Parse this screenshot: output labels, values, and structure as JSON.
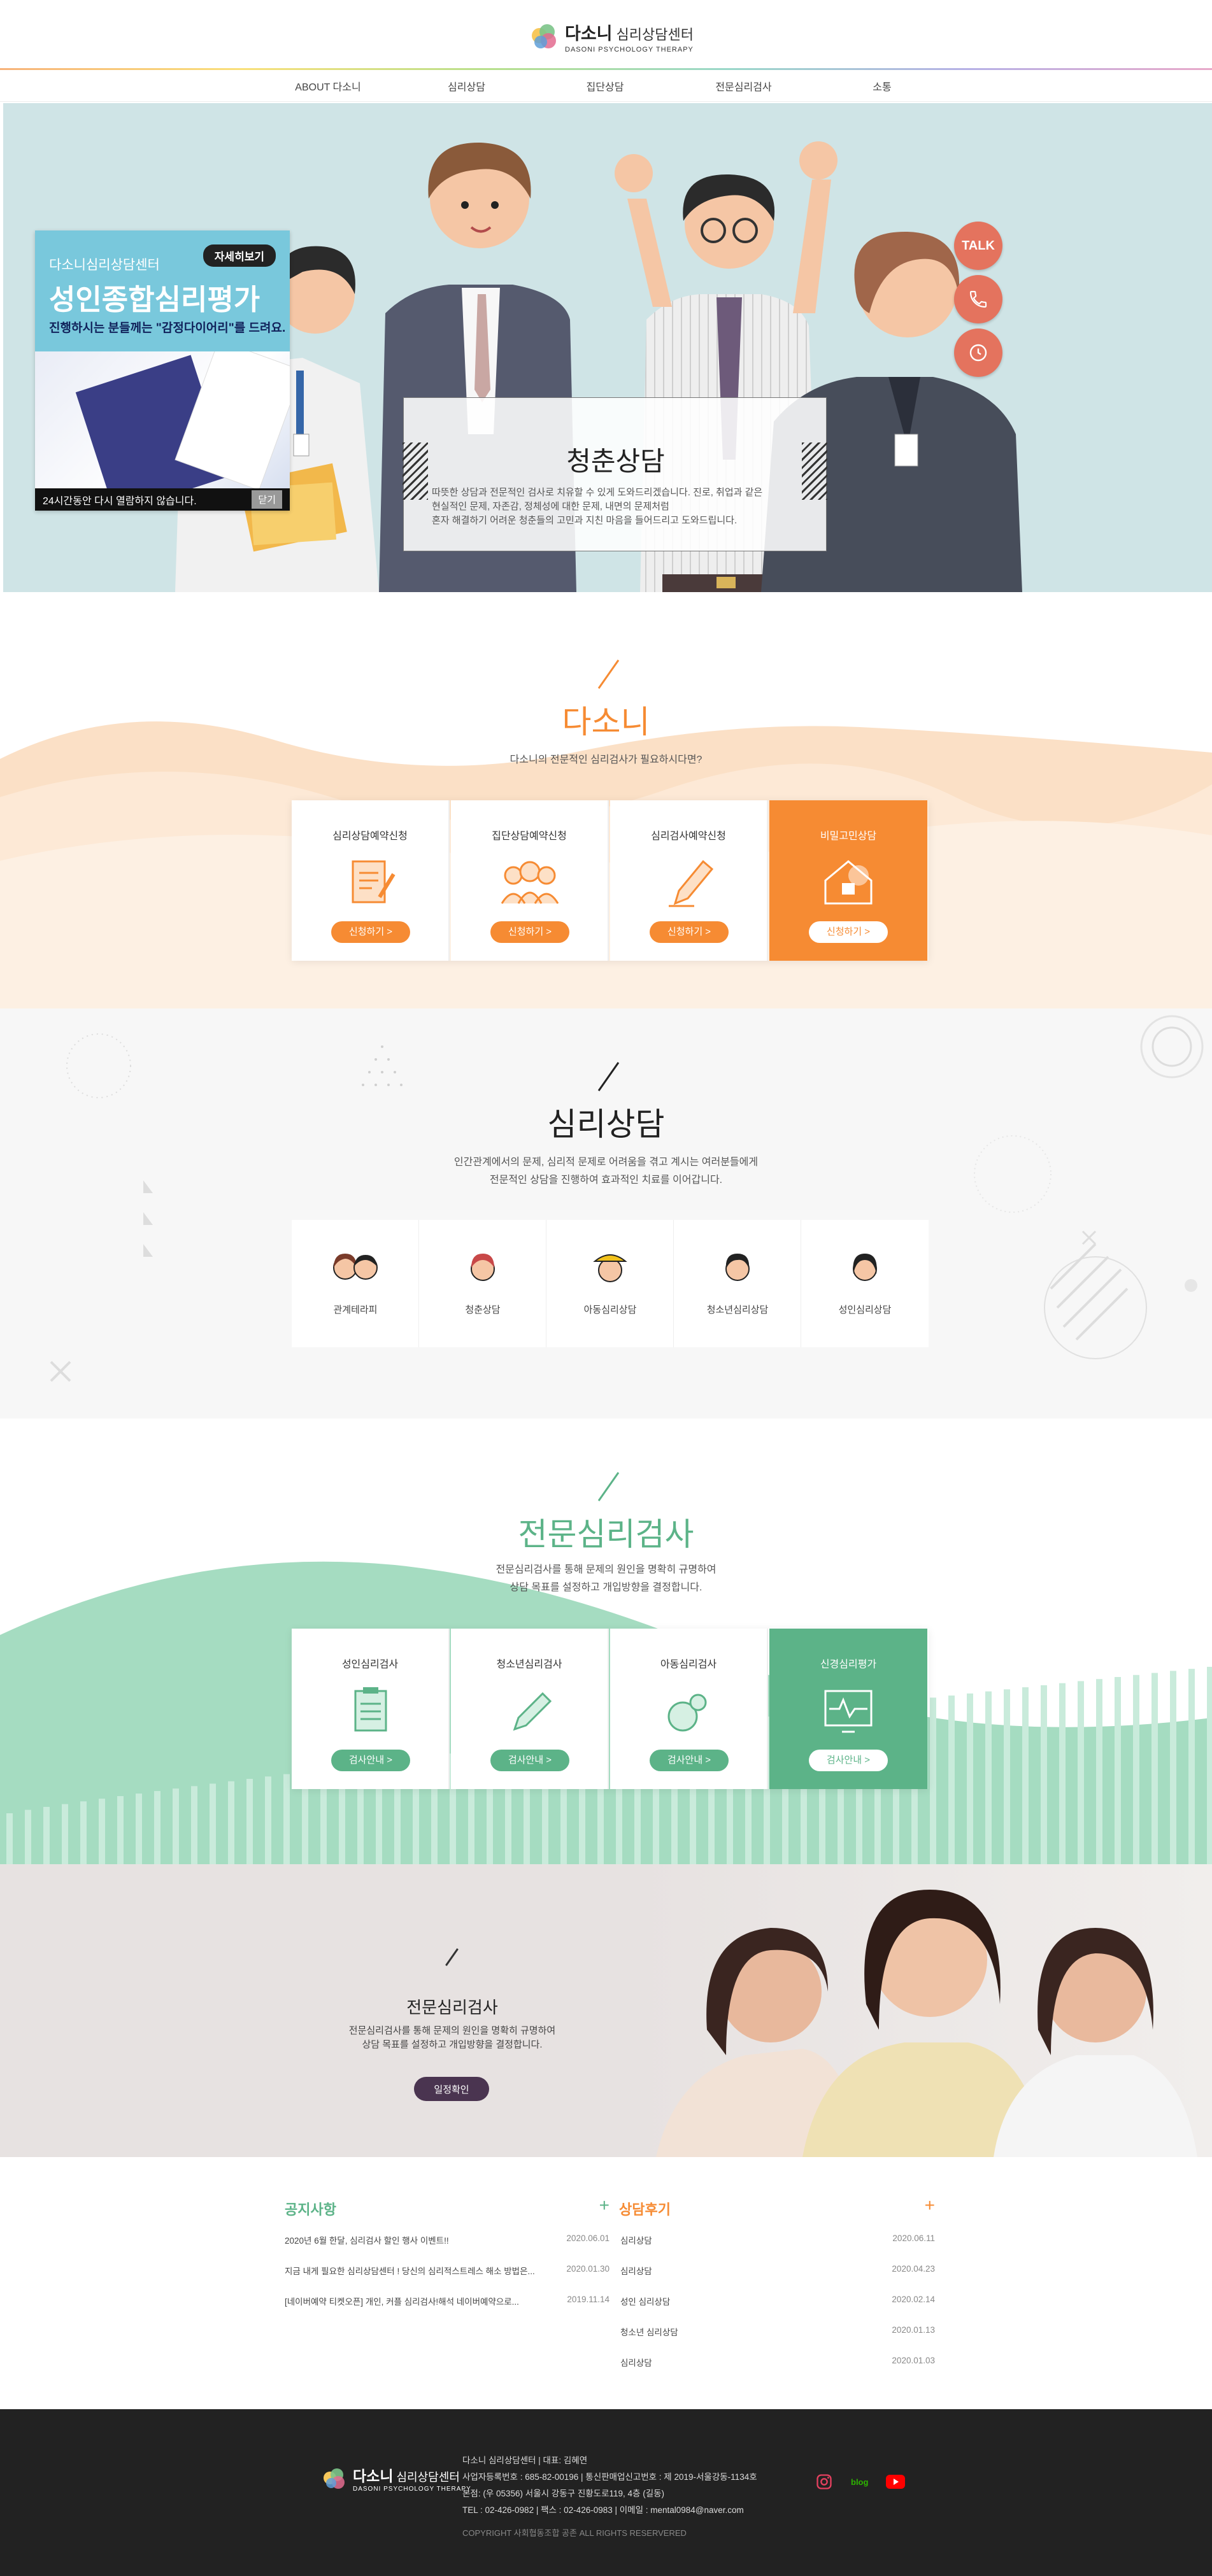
{
  "header": {
    "logo_name": "다소니",
    "logo_suffix": "심리상담센터",
    "logo_sub": "DASONI PSYCHOLOGY THERAPY",
    "nav": [
      "ABOUT 다소니",
      "심리상담",
      "집단상담",
      "전문심리검사",
      "소통"
    ]
  },
  "popup": {
    "sub": "다소니심리상담센터",
    "badge": "자세히보기",
    "title": "성인종합심리평가",
    "desc": "진행하시는 분들께는 \"감정다이어리\"를 드려요.",
    "hide_text": "24시간동안 다시 열람하지 않습니다.",
    "close": "닫기"
  },
  "hero": {
    "title": "청춘상담",
    "desc_lines": [
      "따뜻한 상담과 전문적인 검사로 치유할 수 있게 도와드리겠습니다. 진로, 취업과 같은",
      "현실적인 문제, 자존감, 정체성에 대한 문제, 내면의 문제처럼",
      "혼자 해결하기 어려운 청춘들의 고민과 지친 마음을 들어드리고 도와드립니다."
    ],
    "side_talk": "TALK"
  },
  "dasoni": {
    "title": "다소니",
    "sub": "다소니의 전문적인 심리검사가 필요하시다면?",
    "cards": [
      {
        "title": "심리상담예약신청",
        "button": "신청하기 >"
      },
      {
        "title": "집단상담예약신청",
        "button": "신청하기 >"
      },
      {
        "title": "심리검사예약신청",
        "button": "신청하기 >"
      },
      {
        "title": "비밀고민상담",
        "button": "신청하기 >"
      }
    ]
  },
  "counsel": {
    "title": "심리상담",
    "sub1": "인간관계에서의 문제, 심리적 문제로 어려움을 겪고 계시는 여러분들에게",
    "sub2": "전문적인 상담을 진행하여 효과적인 치료를 이어갑니다.",
    "items": [
      "관계테라피",
      "청춘상담",
      "아동심리상담",
      "청소년심리상담",
      "성인심리상담"
    ]
  },
  "test": {
    "title": "전문심리검사",
    "sub1": "전문심리검사를 통해 문제의 원인을 명확히 규명하여",
    "sub2": "상담 목표를 설정하고 개입방향을 결정합니다.",
    "cards": [
      {
        "title": "성인심리검사",
        "button": "검사안내 >"
      },
      {
        "title": "청소년심리검사",
        "button": "검사안내 >"
      },
      {
        "title": "아동심리검사",
        "button": "검사안내 >"
      },
      {
        "title": "신경심리평가",
        "button": "검사안내 >"
      }
    ]
  },
  "photo": {
    "title": "전문심리검사",
    "sub1": "전문심리검사를 통해 문제의 원인을 명확히 규명하여",
    "sub2": "상담 목표를 설정하고 개입방향을 결정합니다.",
    "button": "일정확인"
  },
  "notice": {
    "title": "공지사항",
    "plus": "+",
    "rows": [
      {
        "title": "2020년 6월 한달, 심리검사 할인 행사 이벤트!!",
        "date": "2020.06.01"
      },
      {
        "title": "지금 내게 필요한 심리상담센터 ! 당신의 심리적스트레스 해소 방법은...",
        "date": "2020.01.30"
      },
      {
        "title": "[네이버예약 티켓오픈] 개인, 커플 심리검사!해석 네이버예약으로...",
        "date": "2019.11.14"
      }
    ]
  },
  "review": {
    "title": "상담후기",
    "plus": "+",
    "rows": [
      {
        "title": "심리상담",
        "date": "2020.06.11"
      },
      {
        "title": "심리상담",
        "date": "2020.04.23"
      },
      {
        "title": "성인 심리상담",
        "date": "2020.02.14"
      },
      {
        "title": "청소년 심리상담",
        "date": "2020.01.13"
      },
      {
        "title": "심리상담",
        "date": "2020.01.03"
      }
    ]
  },
  "footer": {
    "logo_name": "다소니",
    "logo_suffix": "심리상담센터",
    "logo_sub": "DASONI PSYCHOLOGY THERAPY",
    "line1": "다소니 심리상담센터  |  대표: 김혜연",
    "line2": "사업자등록번호 : 685-82-00196  |  통신판매업신고번호 : 제 2019-서울강동-1134호",
    "line3": "본점: (우 05356) 서울시 강동구 진황도로119, 4층 (길동)",
    "line4": "TEL : 02-426-0982  |  팩스 : 02-426-0983  |  이메일 : mental0984@naver.com",
    "copy": "COPYRIGHT 사회협동조합 공존 ALL RIGHTS RESERVERED",
    "blog": "blog"
  },
  "colors": {
    "orange": "#f68b33",
    "green": "#5cb388",
    "purple": "#4a3450",
    "coral": "#e4735e"
  },
  "icons": [
    "talk-icon",
    "phone-icon",
    "clock-icon",
    "plus-icon",
    "instagram-icon",
    "youtube-icon"
  ]
}
